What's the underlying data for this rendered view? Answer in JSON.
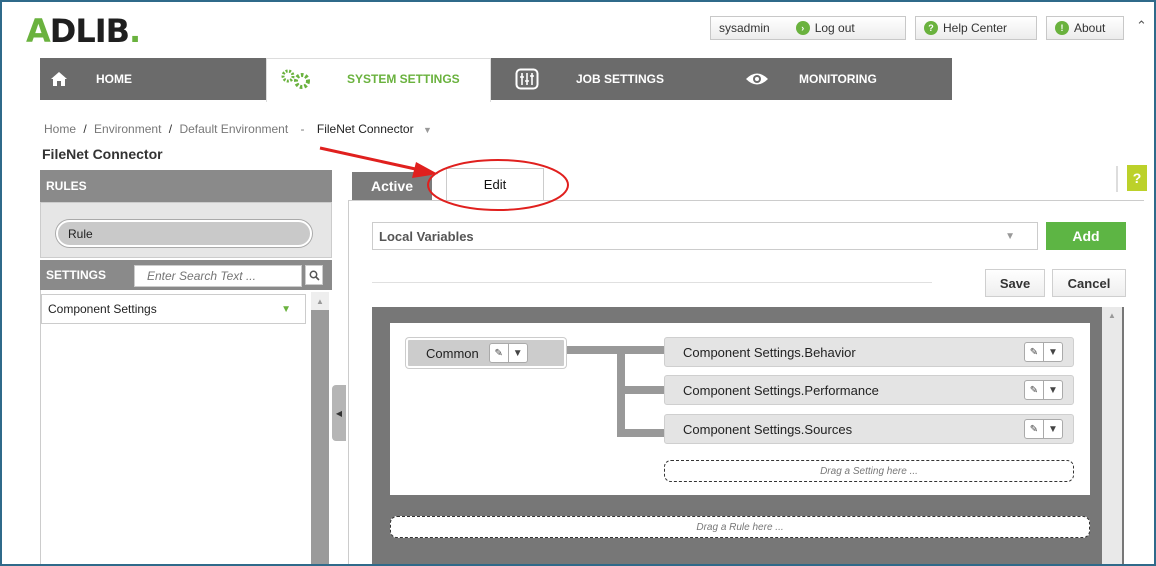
{
  "app": {
    "logo": "ADLIB",
    "logo_suffix": "."
  },
  "topbar": {
    "user": "sysadmin",
    "logout_label": "Log out",
    "help_label": "Help Center",
    "about_label": "About"
  },
  "nav": {
    "home_label": "HOME",
    "system_settings_label": "SYSTEM SETTINGS",
    "job_settings_label": "JOB SETTINGS",
    "monitoring_label": "MONITORING"
  },
  "breadcrumb": {
    "items": [
      "Home",
      "Environment",
      "Default Environment"
    ],
    "sep1": "/",
    "sep2": "/",
    "sep3": "-",
    "current": "FileNet Connector"
  },
  "page": {
    "title": "FileNet Connector"
  },
  "rules": {
    "header": "RULES",
    "rule_label": "Rule"
  },
  "settings": {
    "header": "SETTINGS",
    "search_placeholder": "Enter Search Text ...",
    "selected": "Component Settings"
  },
  "tabs": {
    "active_label": "Active",
    "edit_label": "Edit"
  },
  "help_badge": "?",
  "editor": {
    "variables_select": "Local Variables",
    "add_label": "Add",
    "save_label": "Save",
    "cancel_label": "Cancel",
    "common_label": "Common",
    "settings": [
      "Component Settings.Behavior",
      "Component Settings.Performance",
      "Component Settings.Sources"
    ],
    "drag_setting": "Drag a Setting here ...",
    "drag_rule": "Drag a Rule here ..."
  },
  "colors": {
    "accent_green": "#6ab23e",
    "nav_gray": "#6b6b6b",
    "annotation_red": "#e0201e"
  }
}
